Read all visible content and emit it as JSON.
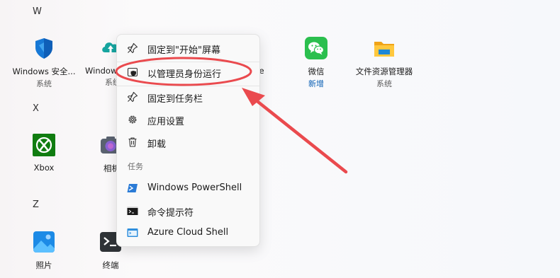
{
  "section_letters": {
    "w": "W",
    "x": "X",
    "z": "Z"
  },
  "apps": {
    "windows_security": {
      "name": "Windows 安全...",
      "sub": "系统"
    },
    "windows_backup": {
      "name": "Windows",
      "sub": "系统"
    },
    "office": {
      "name": "ice"
    },
    "wechat": {
      "name": "微信",
      "sub": "新增"
    },
    "file_explorer": {
      "name": "文件资源管理器",
      "sub": "系统"
    },
    "xbox": {
      "name": "Xbox"
    },
    "camera": {
      "name": "相机"
    },
    "photos": {
      "name": "照片"
    },
    "terminal": {
      "name": "终端"
    }
  },
  "context_menu": {
    "pin_start": "固定到\"开始\"屏幕",
    "run_as_admin": "以管理员身份运行",
    "pin_taskbar": "固定到任务栏",
    "app_settings": "应用设置",
    "uninstall": "卸载",
    "tasks_heading": "任务",
    "task_powershell": "Windows PowerShell",
    "task_cmd": "命令提示符",
    "task_cloud_shell": "Azure Cloud Shell"
  },
  "icons": {
    "pin": "pin-icon",
    "shield": "admin-shield-icon",
    "gear": "gear-icon",
    "trash": "trash-icon",
    "powershell": "powershell-icon",
    "cmd": "cmd-icon",
    "cloud_shell": "cloud-shell-icon"
  },
  "colors": {
    "annotation_red": "#ea4a4e",
    "accent_blue": "#0a5fb4",
    "wechat_green": "#2bbf4e",
    "xbox_green": "#107c10"
  }
}
